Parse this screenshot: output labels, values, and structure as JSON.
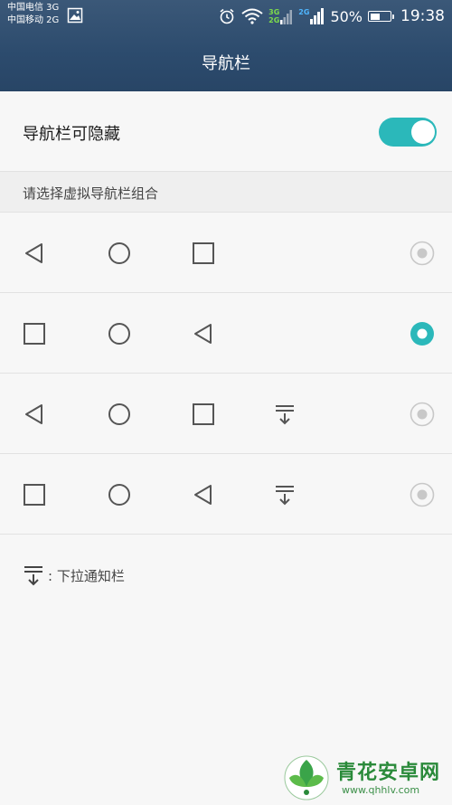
{
  "status_bar": {
    "carrier_1": "中国电信 3G",
    "carrier_2": "中国移动 2G",
    "net_tag_3g": "3G",
    "net_tag_2g_a": "2G",
    "net_tag_2g_b": "2G",
    "battery_percent": "50%",
    "battery_level": 0.5,
    "time": "19:38"
  },
  "header": {
    "title": "导航栏"
  },
  "toggle": {
    "label": "导航栏可隐藏",
    "on": true
  },
  "section": {
    "header": "请选择虚拟导航栏组合"
  },
  "options": [
    {
      "icons": [
        "back-icon",
        "home-icon",
        "recent-apps-icon"
      ],
      "selected": false
    },
    {
      "icons": [
        "recent-apps-icon",
        "home-icon",
        "back-icon"
      ],
      "selected": true
    },
    {
      "icons": [
        "back-icon",
        "home-icon",
        "recent-apps-icon",
        "notification-pull-icon"
      ],
      "selected": false
    },
    {
      "icons": [
        "recent-apps-icon",
        "home-icon",
        "back-icon",
        "notification-pull-icon"
      ],
      "selected": false
    }
  ],
  "legend": {
    "text": ": 下拉通知栏"
  },
  "watermark": {
    "name": "青花安卓网",
    "url": "www.qhhlv.com"
  },
  "colors": {
    "accent": "#2bb8ba",
    "header_bg": "#2f4e70",
    "icon": "#555555",
    "watermark": "#2a8a3a"
  }
}
